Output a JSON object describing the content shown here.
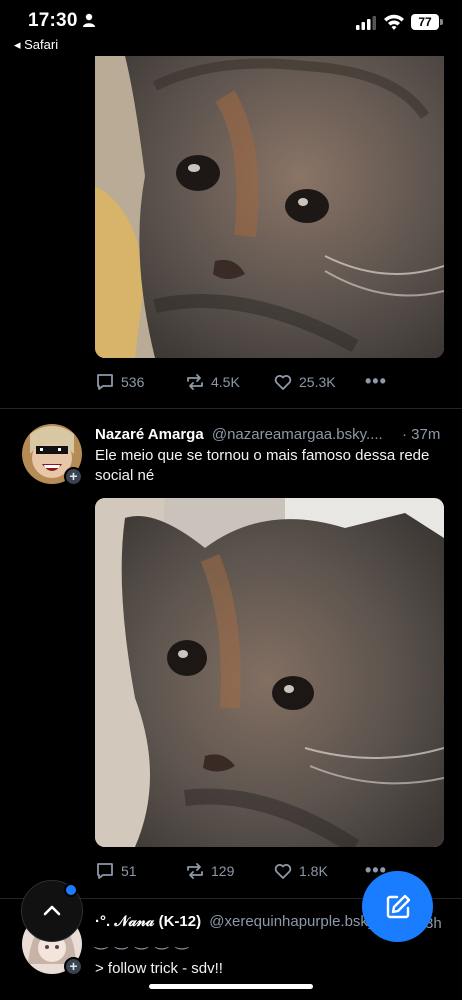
{
  "status_bar": {
    "time": "17:30",
    "back_app": "◂ Safari",
    "battery": "77"
  },
  "posts": [
    {
      "image_alt": "close-up photo of a grey tabby cat",
      "replies": "536",
      "reposts": "4.5K",
      "likes": "25.3K"
    },
    {
      "display_name": "Nazaré Amarga",
      "handle": "@nazareamargaa.bsky....",
      "time": "· 37m",
      "text": "Ele meio que se tornou o mais famoso dessa rede social né",
      "image_alt": "close-up photo of a grey tabby cat",
      "replies": "51",
      "reposts": "129",
      "likes": "1.8K"
    },
    {
      "display_name": "·°. 𝒩𝒶𝓃𝒶 (K-12)",
      "handle": "@xerequinhapurple.bsky...",
      "time": "3h",
      "text_line1": "‿ ‿ ‿ ‿ ‿",
      "text_line2": "> follow trick - sdv!!"
    }
  ],
  "icons": {
    "reply": "speech-bubble-icon",
    "repost": "repost-arrows-icon",
    "like": "heart-icon",
    "more": "ellipsis-icon",
    "compose": "compose-pencil-icon",
    "scroll_top": "chevron-up-icon"
  },
  "colors": {
    "background": "#000000",
    "muted": "#8d99a8",
    "accent": "#1a7cff"
  }
}
